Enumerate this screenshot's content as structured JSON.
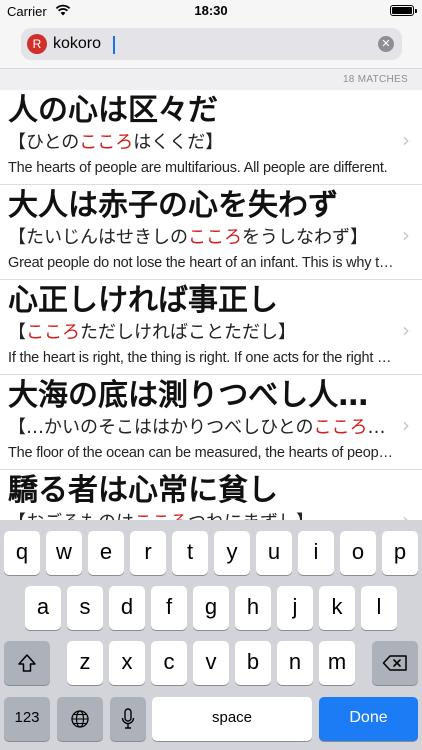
{
  "status_bar": {
    "carrier": "Carrier",
    "time": "18:30",
    "wifi_icon": "wifi-icon",
    "battery_icon": "battery-icon"
  },
  "search": {
    "badge": "R",
    "value": "kokoro",
    "clear_icon": "close-icon",
    "clear_glyph": "✕"
  },
  "results": {
    "count_label": "18 MATCHES",
    "chevron": "›",
    "items": [
      {
        "title": "人の心は区々だ",
        "reading_pre": "【ひとの",
        "reading_hl": "こころ",
        "reading_post": "はくくだ】",
        "meaning": "The hearts of people are multifarious. All people are different."
      },
      {
        "title": "大人は赤子の心を失わず",
        "reading_pre": "【たいじんはせきしの",
        "reading_hl": "こころ",
        "reading_post": "をうしなわず】",
        "meaning": "Great people do not lose the heart of an infant. This is why they are great."
      },
      {
        "title": "心正しければ事正し",
        "reading_pre": "【",
        "reading_hl": "こころ",
        "reading_post": "ただしければことただし】",
        "meaning": "If the heart is right, the thing is right. If one acts for the right reasons."
      },
      {
        "title": "大海の底は測りつべし人…",
        "reading_pre": "【…かいのそこははかりつべしひとの",
        "reading_hl": "こころ",
        "reading_post": "…",
        "meaning": "The floor of the ocean can be measured, the hearts of people cannot."
      },
      {
        "title": "驕る者は心常に貧し",
        "reading_pre": "【おごるものは",
        "reading_hl": "こころ",
        "reading_post": "つねにまずし】",
        "meaning": ""
      }
    ]
  },
  "keyboard": {
    "row1": [
      "q",
      "w",
      "e",
      "r",
      "t",
      "y",
      "u",
      "i",
      "o",
      "p"
    ],
    "row2": [
      "a",
      "s",
      "d",
      "f",
      "g",
      "h",
      "j",
      "k",
      "l"
    ],
    "row3": [
      "z",
      "x",
      "c",
      "v",
      "b",
      "n",
      "m"
    ],
    "shift_icon": "shift-icon",
    "backspace_icon": "backspace-icon",
    "numbers_label": "123",
    "globe_icon": "globe-icon",
    "mic_icon": "microphone-icon",
    "space_label": "space",
    "done_label": "Done"
  }
}
